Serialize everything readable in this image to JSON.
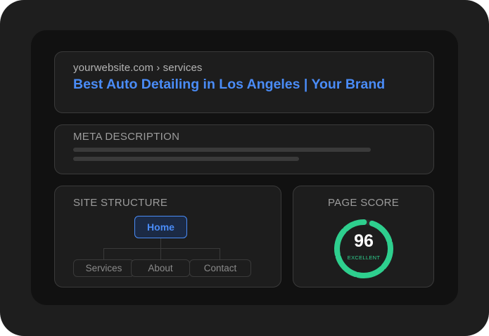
{
  "serp": {
    "breadcrumb": "yourwebsite.com › services",
    "title": "Best Auto Detailing in Los Angeles | Your Brand"
  },
  "meta": {
    "label": "META DESCRIPTION"
  },
  "structure": {
    "label": "SITE STRUCTURE",
    "root": "Home",
    "children": [
      "Services",
      "About",
      "Contact"
    ]
  },
  "score": {
    "label": "PAGE SCORE",
    "value": "96",
    "rating": "EXCELLENT",
    "percent": 96
  },
  "colors": {
    "link": "#4a8cf7",
    "score": "#2ecf8e",
    "device": "#1e1e1e",
    "screen": "#111111"
  }
}
